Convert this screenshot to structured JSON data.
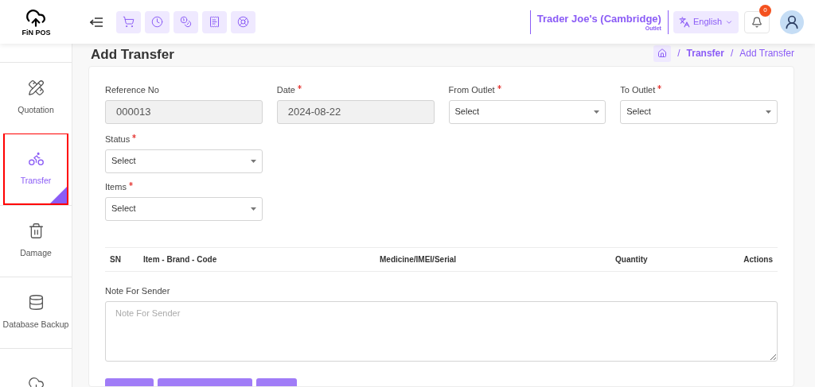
{
  "header": {
    "logo_text": "FiN POS",
    "outlet_name": "Trader Joe's (Cambridge)",
    "outlet_label": "Outlet",
    "language": "English",
    "notification_count": "0"
  },
  "sidebar": {
    "items": [
      {
        "kind": "quotation",
        "label": "Quotation",
        "selected": false
      },
      {
        "kind": "transfer",
        "label": "Transfer",
        "selected": true
      },
      {
        "kind": "damage",
        "label": "Damage",
        "selected": false
      },
      {
        "kind": "database",
        "label": "Database Backup",
        "selected": false
      },
      {
        "kind": "cloud",
        "selected": false
      }
    ]
  },
  "page": {
    "title": "Add Transfer",
    "breadcrumb": [
      {
        "separator": "/",
        "label": "Transfer"
      },
      {
        "separator": "/",
        "label": "Add Transfer"
      }
    ]
  },
  "form": {
    "fields": [
      {
        "label": "Reference No",
        "required": false,
        "kind": "text",
        "value": "000013",
        "disabled": true
      },
      {
        "label": "Date",
        "required": true,
        "kind": "text",
        "value": "2024-08-22",
        "disabled": true
      },
      {
        "label": "From Outlet",
        "required": true,
        "kind": "select",
        "value": "Select"
      },
      {
        "label": "To Outlet",
        "required": true,
        "kind": "select",
        "value": "Select"
      },
      {
        "label": "Status",
        "required": true,
        "kind": "select",
        "value": "Select"
      },
      {
        "label": "Items",
        "required": true,
        "kind": "select",
        "value": "Select"
      }
    ]
  },
  "table": {
    "columns": [
      "SN",
      "Item - Brand - Code",
      "Medicine/IMEI/Serial",
      "Quantity",
      "Actions"
    ]
  },
  "note": {
    "label": "Note For Sender",
    "placeholder": "Note For Sender"
  }
}
